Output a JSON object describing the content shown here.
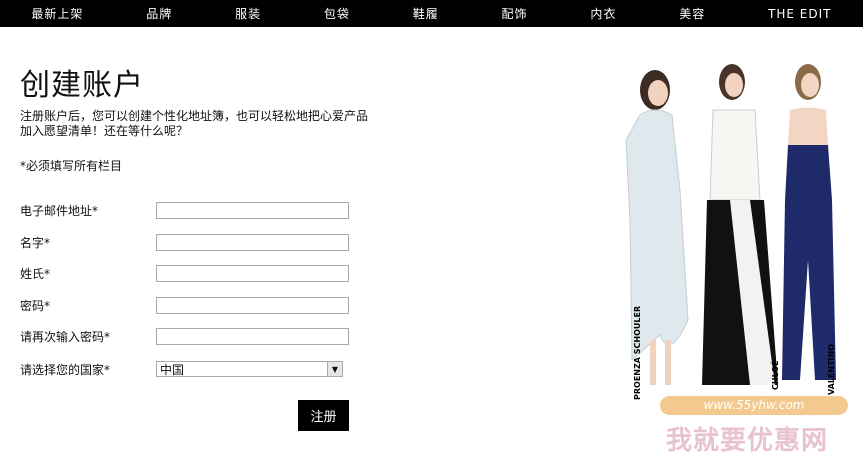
{
  "nav": {
    "items": [
      "最新上架",
      "品牌",
      "服装",
      "包袋",
      "鞋履",
      "配饰",
      "内衣",
      "美容",
      "THE EDIT"
    ]
  },
  "page": {
    "title": "创建账户",
    "intro_line1": "注册账户后，您可以创建个性化地址簿，也可以轻松地把心爱产品",
    "intro_line2": "加入愿望清单！还在等什么呢？",
    "required_note": "*必须填写所有栏目"
  },
  "form": {
    "email_label": "电子邮件地址*",
    "first_name_label": "名字*",
    "last_name_label": "姓氏*",
    "password_label": "密码*",
    "confirm_password_label": "请再次输入密码*",
    "country_label": "请选择您的国家*",
    "country_value": "中国",
    "submit_label": "注册"
  },
  "image": {
    "brand_labels": [
      "PROENZA SCHOULER",
      "CHLOÉ",
      "VALENTINO"
    ]
  },
  "watermark": {
    "url": "www.55yhw.com",
    "name": "我就要优惠网"
  },
  "colors": {
    "nav_bg": "#000000",
    "button_bg": "#000000"
  }
}
